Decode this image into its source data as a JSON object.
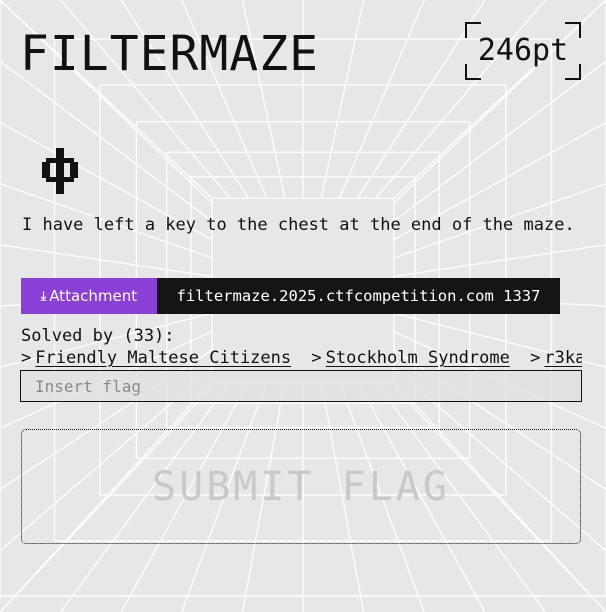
{
  "challenge": {
    "title": "FILTERMAZE",
    "points": "246pt",
    "category_icon": "phi-icon",
    "description": "I have left a key to the chest at the end of the maze.",
    "attachment": {
      "icon": "download-arrow-icon",
      "label": "Attachment"
    },
    "connection": "filtermaze.2025.ctfcompetition.com 1337"
  },
  "solves": {
    "heading": "Solved by (33):",
    "chevron": ">",
    "teams": [
      "Friendly Maltese Citizens",
      "Stockholm Syndrome",
      "r3ka"
    ]
  },
  "flag_form": {
    "placeholder": "Insert flag",
    "value": "",
    "submit_label": "SUBMIT FLAG"
  },
  "colors": {
    "background": "#e7e7e7",
    "grid_lines": "#ffffff",
    "attachment_accent": "#8a3fd6",
    "connection_background": "#151515",
    "submit_text": "#c9c9c9"
  }
}
